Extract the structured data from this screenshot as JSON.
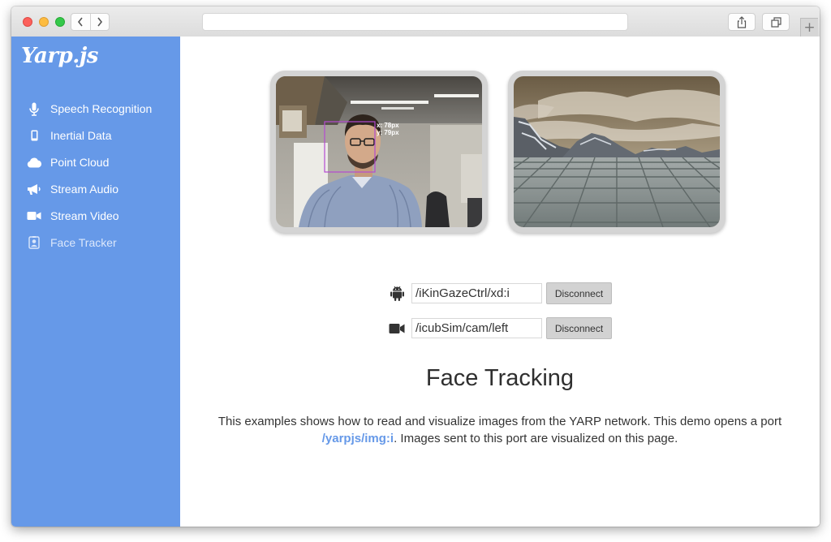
{
  "sidebar": {
    "logo": "Yarp.js",
    "items": [
      {
        "label": "Speech Recognition",
        "icon": "microphone-icon"
      },
      {
        "label": "Inertial Data",
        "icon": "mobile-phone-icon"
      },
      {
        "label": "Point Cloud",
        "icon": "cloud-icon"
      },
      {
        "label": "Stream Audio",
        "icon": "megaphone-icon"
      },
      {
        "label": "Stream Video",
        "icon": "video-camera-icon"
      },
      {
        "label": "Face Tracker",
        "icon": "user-badge-icon",
        "active": true
      }
    ],
    "accent": "#6699e8"
  },
  "viewer": {
    "face_overlay": {
      "x_label": "x: 78px",
      "y_label": "y: 79px"
    }
  },
  "ports": [
    {
      "icon": "android-icon",
      "value": "/iKinGazeCtrl/xd:i",
      "button": "Disconnect"
    },
    {
      "icon": "video-camera-icon",
      "value": "/icubSim/cam/left",
      "button": "Disconnect"
    }
  ],
  "content": {
    "title": "Face Tracking",
    "text_before": "This examples shows how to read and visualize images from the YARP network. This demo opens a port",
    "port_link": "/yarpjs/img:i",
    "text_after": ". Images sent to this port are visualized on this page."
  }
}
